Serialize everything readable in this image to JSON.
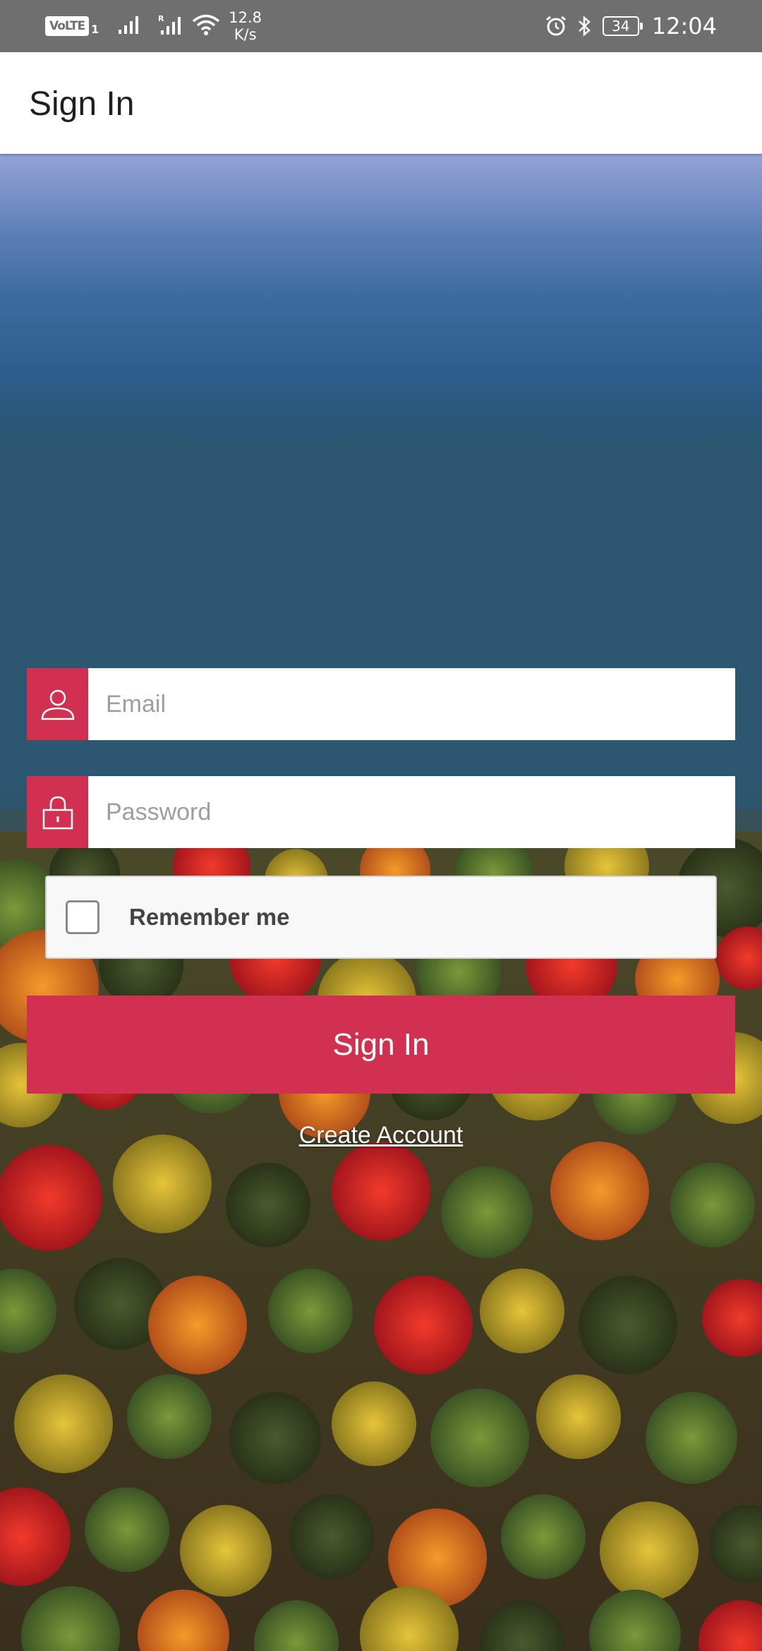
{
  "status_bar": {
    "volte_label": "VoLTE",
    "volte_sub": "1",
    "net_speed_value": "12.8",
    "net_speed_unit": "K/s",
    "battery": "34",
    "time": "12:04",
    "icons": [
      "signal-icon",
      "roaming-signal-icon",
      "wifi-icon",
      "alarm-icon",
      "bluetooth-icon",
      "battery-icon"
    ]
  },
  "app_bar": {
    "title": "Sign In"
  },
  "form": {
    "email": {
      "value": "",
      "placeholder": "Email",
      "icon": "user-icon"
    },
    "password": {
      "value": "",
      "placeholder": "Password",
      "icon": "lock-icon"
    },
    "remember_label": "Remember me",
    "remember_checked": false,
    "submit_label": "Sign In",
    "create_account_label": "Create Account"
  },
  "colors": {
    "accent": "#d23050",
    "status_bar": "#6f6f6f",
    "app_bar": "#ffffff"
  }
}
